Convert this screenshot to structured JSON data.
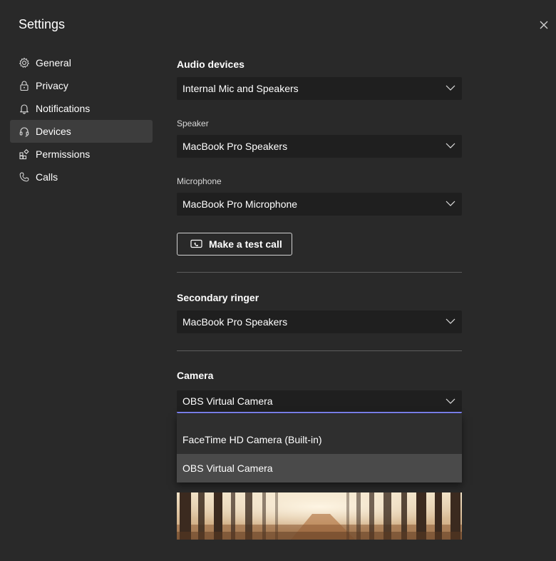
{
  "window": {
    "title": "Settings"
  },
  "sidebar": {
    "items": [
      {
        "label": "General",
        "icon": "gear-icon"
      },
      {
        "label": "Privacy",
        "icon": "lock-icon"
      },
      {
        "label": "Notifications",
        "icon": "bell-icon"
      },
      {
        "label": "Devices",
        "icon": "headset-icon",
        "active": true
      },
      {
        "label": "Permissions",
        "icon": "apps-icon"
      },
      {
        "label": "Calls",
        "icon": "phone-icon"
      }
    ]
  },
  "audio": {
    "title": "Audio devices",
    "device_value": "Internal Mic and Speakers",
    "speaker_label": "Speaker",
    "speaker_value": "MacBook Pro Speakers",
    "microphone_label": "Microphone",
    "microphone_value": "MacBook Pro Microphone",
    "test_call_label": "Make a test call"
  },
  "secondary_ringer": {
    "title": "Secondary ringer",
    "value": "MacBook Pro Speakers"
  },
  "camera": {
    "title": "Camera",
    "value": "OBS Virtual Camera",
    "options": [
      {
        "label": "FaceTime HD Camera (Built-in)",
        "selected": false
      },
      {
        "label": "OBS Virtual Camera",
        "selected": true
      }
    ]
  },
  "colors": {
    "background": "#292929",
    "select_background": "#1f1f1f",
    "focus_underline": "#7f85f5",
    "active_nav": "#3d3d3d"
  }
}
